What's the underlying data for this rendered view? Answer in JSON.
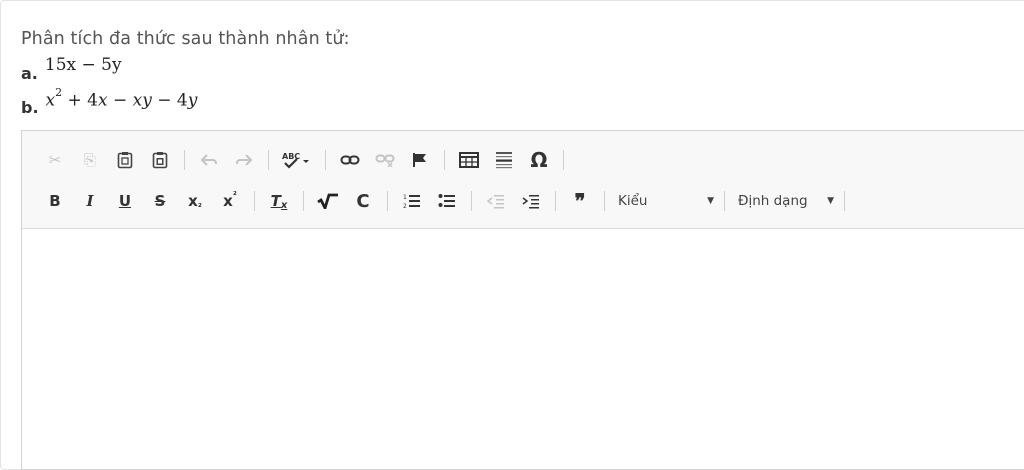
{
  "question": {
    "prompt": "Phân tích đa thức sau thành nhân tử:",
    "items": [
      {
        "label": "a.",
        "expr": "15x − 5y"
      },
      {
        "label": "b.",
        "expr_html": "x² + 4x − xy − 4y"
      }
    ]
  },
  "toolbar": {
    "row1": [
      {
        "name": "cut-icon",
        "glyph": "✂",
        "disabled": true
      },
      {
        "name": "copy-icon",
        "glyph": "⎘",
        "disabled": true
      },
      {
        "name": "paste-icon",
        "glyph": "📋",
        "disabled": false
      },
      {
        "name": "paste-from-word-icon",
        "glyph": "📄",
        "disabled": false
      },
      {
        "name": "undo-icon",
        "glyph": "↶",
        "disabled": true
      },
      {
        "name": "redo-icon",
        "glyph": "↷",
        "disabled": true
      },
      {
        "name": "spellcheck-icon",
        "glyph": "ABC✔",
        "disabled": false
      },
      {
        "name": "link-icon",
        "glyph": "⛓",
        "disabled": false
      },
      {
        "name": "unlink-icon",
        "glyph": "⛓",
        "disabled": true
      },
      {
        "name": "anchor-flag-icon",
        "glyph": "⚑",
        "disabled": false
      },
      {
        "name": "table-icon",
        "glyph": "▦",
        "disabled": false
      },
      {
        "name": "horizontal-line-icon",
        "glyph": "☰",
        "disabled": false
      },
      {
        "name": "special-char-icon",
        "glyph": "Ω",
        "disabled": false
      }
    ],
    "row2": {
      "bold": "B",
      "italic": "I",
      "underline": "U",
      "strike": "S",
      "subscript": "x₂",
      "superscript": "x²",
      "remove_format": "Tₓ",
      "sqrt": "√‾",
      "c_symbol": "C",
      "numbered_list": "⒈≡",
      "bullet_list": "•≡",
      "outdent": "⇤≡",
      "indent": "⇥≡",
      "blockquote": "❞",
      "styles_combo": "Kiểu",
      "format_combo": "Định dạng"
    }
  }
}
